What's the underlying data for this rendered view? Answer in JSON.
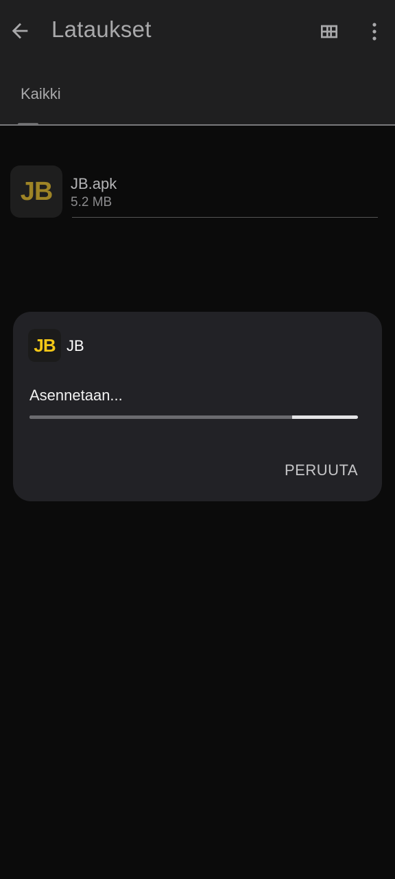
{
  "appbar": {
    "title": "Lataukset",
    "back_icon": "arrow-back-icon",
    "view_icon": "grid-view-icon",
    "more_icon": "more-vert-icon"
  },
  "tabs": [
    {
      "label": "Kaikki",
      "selected": true
    }
  ],
  "files": [
    {
      "icon_text": "JB",
      "name": "JB.apk",
      "size": "5.2 MB"
    }
  ],
  "dialog": {
    "icon_text": "JB",
    "title": "JB",
    "status": "Asennetaan...",
    "progress": 0.8,
    "cancel_label": "PERUUTA"
  },
  "colors": {
    "background": "#0b0b0b",
    "appbar": "#1f1f20",
    "dialog": "#222226",
    "brand_yellow": "#f4c817"
  }
}
